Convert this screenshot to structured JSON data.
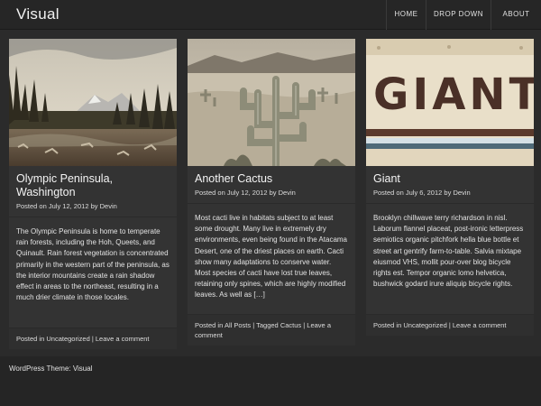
{
  "site": {
    "title": "Visual"
  },
  "nav": {
    "home": "HOME",
    "dropdown": "DROP DOWN",
    "about": "ABOUT"
  },
  "posts": [
    {
      "title": "Olympic Peninsula, Washington",
      "posted_on": "Posted on",
      "date": "July 12, 2012",
      "by": "by",
      "author": "Devin",
      "excerpt": "The Olympic Peninsula is home to temperate rain forests, including the Hoh, Queets, and Quinault. Rain forest vegetation is concentrated primarily in the western part of the peninsula, as the interior mountains create a rain shadow effect in areas to the northeast, resulting in a much drier climate in those locales.",
      "posted_in": "Posted in",
      "categories": "Uncategorized",
      "tagged": "",
      "tags": "",
      "comment": "Leave a comment"
    },
    {
      "title": "Another Cactus",
      "posted_on": "Posted on",
      "date": "July 12, 2012",
      "by": "by",
      "author": "Devin",
      "excerpt": "Most cacti live in habitats subject to at least some drought. Many live in extremely dry environments, even being found in the Atacama Desert, one of the driest places on earth. Cacti show many adaptations to conserve water. Most species of cacti have lost true leaves, retaining only spines, which are highly modified leaves. As well as […]",
      "posted_in": "Posted in",
      "categories": "All Posts",
      "tagged": "Tagged",
      "tags": "Cactus",
      "comment": "Leave a comment"
    },
    {
      "title": "Giant",
      "posted_on": "Posted on",
      "date": "July 6, 2012",
      "by": "by",
      "author": "Devin",
      "excerpt": "Brooklyn chillwave terry richardson in nisl. Laborum flannel placeat, post-ironic letterpress semiotics organic pitchfork hella blue bottle et street art gentrify farm-to-table. Salvia mixtape eiusmod VHS, mollit pour-over blog bicycle rights est. Tempor organic lomo helvetica, bushwick godard irure aliquip bicycle rights.",
      "posted_in": "Posted in",
      "categories": "Uncategorized",
      "tagged": "",
      "tags": "",
      "comment": "Leave a comment",
      "sign_text": "GIANT"
    }
  ],
  "footer": {
    "credit": "WordPress Theme: Visual"
  },
  "colors": {
    "background": "#2b2b2b",
    "card": "#333333",
    "header": "#262626"
  }
}
